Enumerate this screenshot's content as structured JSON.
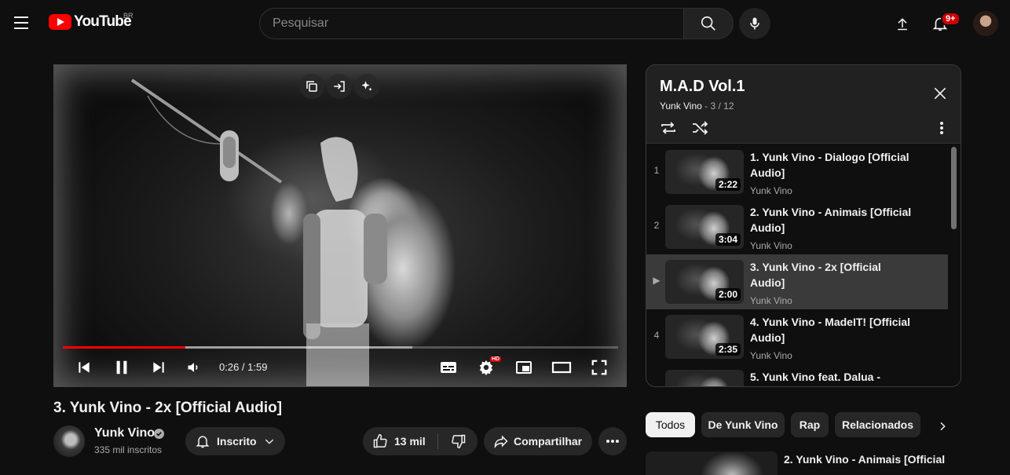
{
  "header": {
    "logo_text": "YouTube",
    "country": "BR",
    "search_placeholder": "Pesquisar",
    "notifications_count": "9+"
  },
  "player": {
    "current_time": "0:26",
    "duration": "1:59",
    "time_separator": " / ",
    "progress_played": 0.22,
    "progress_buffered": 0.63,
    "hd_badge": "HD",
    "state": "playing"
  },
  "playlist": {
    "title": "M.A.D Vol.1",
    "owner": "Yunk Vino",
    "position": " - 3 / 12",
    "items": [
      {
        "index": "1",
        "title": "1. Yunk Vino - Dialogo [Official Audio]",
        "channel": "Yunk Vino",
        "duration": "2:22"
      },
      {
        "index": "2",
        "title": "2. Yunk Vino - Animais [Official Audio]",
        "channel": "Yunk Vino",
        "duration": "3:04"
      },
      {
        "index": "▶",
        "title": "3. Yunk Vino - 2x [Official Audio]",
        "channel": "Yunk Vino",
        "duration": "2:00"
      },
      {
        "index": "4",
        "title": "4. Yunk Vino - MadeIT! [Official Audio]",
        "channel": "Yunk Vino",
        "duration": "2:35"
      },
      {
        "index": "5",
        "title": "5. Yunk Vino feat. Dalua -",
        "channel": "",
        "duration": ""
      }
    ]
  },
  "video": {
    "title": "3. Yunk Vino - 2x [Official Audio]",
    "channel_name": "Yunk Vino",
    "subscribers": "335 mil inscritos",
    "subscribe_label": "Inscrito",
    "likes": "13 mil",
    "share_label": "Compartilhar"
  },
  "chips": [
    {
      "label": "Todos",
      "active": true
    },
    {
      "label": "De Yunk Vino",
      "active": false
    },
    {
      "label": "Rap",
      "active": false
    },
    {
      "label": "Relacionados",
      "active": false
    }
  ],
  "recommendation": {
    "title": "2. Yunk Vino - Animais [Official"
  },
  "colors": {
    "accent": "#ff0000",
    "background": "#0f0f0f",
    "surface": "#272727"
  }
}
